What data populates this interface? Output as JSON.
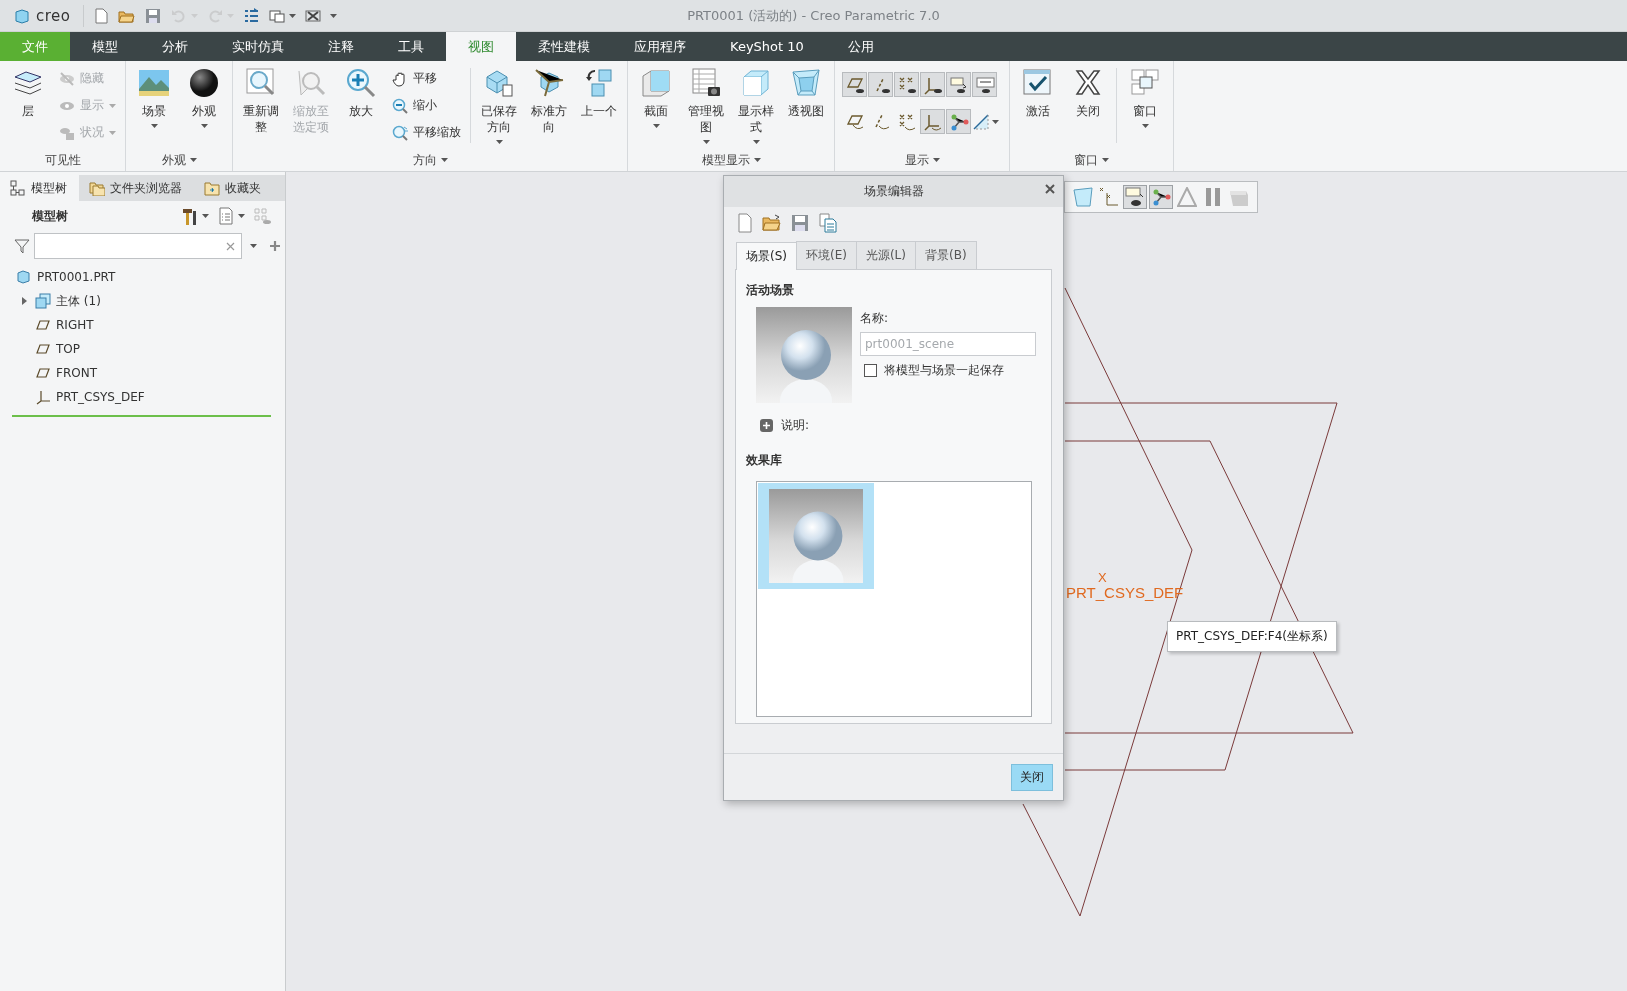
{
  "window": {
    "logo": "creo",
    "title": "PRT0001 (活动的) - Creo Parametric 7.0"
  },
  "quick_access": [
    {
      "disabled": false,
      "dropdown": false
    },
    {
      "disabled": false,
      "dropdown": false
    },
    {
      "disabled": false,
      "dropdown": false
    },
    {
      "disabled": true,
      "dropdown": true
    },
    {
      "disabled": true,
      "dropdown": true
    },
    {
      "disabled": false,
      "dropdown": false
    },
    {
      "disabled": false,
      "dropdown": true
    },
    {
      "disabled": false,
      "dropdown": false
    },
    {
      "disabled": false,
      "dropdown": true
    }
  ],
  "ribbon_tabs": [
    {
      "label": "文件",
      "kind": "file",
      "selected": false
    },
    {
      "label": "模型",
      "kind": "tab",
      "selected": false
    },
    {
      "label": "分析",
      "kind": "tab",
      "selected": false
    },
    {
      "label": "实时仿真",
      "kind": "tab",
      "selected": false
    },
    {
      "label": "注释",
      "kind": "tab",
      "selected": false
    },
    {
      "label": "工具",
      "kind": "tab",
      "selected": false
    },
    {
      "label": "视图",
      "kind": "tab",
      "selected": true
    },
    {
      "label": "柔性建模",
      "kind": "tab",
      "selected": false
    },
    {
      "label": "应用程序",
      "kind": "tab",
      "selected": false
    },
    {
      "label": "KeyShot 10",
      "kind": "tab",
      "selected": false
    },
    {
      "label": "公用",
      "kind": "tab",
      "selected": false
    }
  ],
  "ribbon_groups": [
    {
      "label": "可见性",
      "dropdown": false,
      "items": [
        {
          "kind": "large",
          "label": "层",
          "disabled": false,
          "dropdown": false
        },
        {
          "kind": "stack",
          "entries": [
            {
              "label": "隐藏",
              "disabled": true,
              "dropdown": false
            },
            {
              "label": "显示",
              "disabled": true,
              "dropdown": true
            },
            {
              "label": "状况",
              "disabled": true,
              "dropdown": true
            }
          ]
        }
      ]
    },
    {
      "label": "外观",
      "dropdown": true,
      "items": [
        {
          "kind": "large",
          "label": "场景",
          "disabled": false,
          "dropdown": true
        },
        {
          "kind": "large",
          "label": "外观",
          "disabled": false,
          "dropdown": true
        }
      ]
    },
    {
      "label": "方向",
      "dropdown": true,
      "items": [
        {
          "kind": "large",
          "label": "重新调整",
          "disabled": false,
          "dropdown": false
        },
        {
          "kind": "large",
          "label": "缩放至选定项",
          "disabled": true,
          "dropdown": false
        },
        {
          "kind": "large",
          "label": "放大",
          "disabled": false,
          "dropdown": false
        },
        {
          "kind": "stack",
          "entries": [
            {
              "label": "平移",
              "disabled": false,
              "dropdown": false
            },
            {
              "label": "缩小",
              "disabled": false,
              "dropdown": false
            },
            {
              "label": "平移缩放",
              "disabled": false,
              "dropdown": false
            }
          ]
        },
        {
          "kind": "separator"
        },
        {
          "kind": "large",
          "label": "已保存方向",
          "disabled": false,
          "dropdown": true
        },
        {
          "kind": "large",
          "label": "标准方向",
          "disabled": false,
          "dropdown": false
        },
        {
          "kind": "large",
          "label": "上一个",
          "disabled": false,
          "dropdown": false
        }
      ]
    },
    {
      "label": "模型显示",
      "dropdown": true,
      "items": [
        {
          "kind": "large",
          "label": "截面",
          "disabled": false,
          "dropdown": true
        },
        {
          "kind": "large",
          "label": "管理视图",
          "disabled": false,
          "dropdown": true
        },
        {
          "kind": "large",
          "label": "显示样式",
          "disabled": false,
          "dropdown": true
        },
        {
          "kind": "large",
          "label": "透视图",
          "disabled": false,
          "dropdown": false
        }
      ]
    },
    {
      "label": "显示",
      "dropdown": true,
      "items": [
        {
          "kind": "toggles",
          "rows": [
            [
              {
                "on": true,
                "dropdown": false
              },
              {
                "on": true,
                "dropdown": false
              },
              {
                "on": true,
                "dropdown": false
              },
              {
                "on": true,
                "dropdown": false
              },
              {
                "on": true,
                "dropdown": false
              },
              {
                "on": true,
                "dropdown": false
              }
            ],
            [
              {
                "on": false,
                "dropdown": false
              },
              {
                "on": false,
                "dropdown": false
              },
              {
                "on": false,
                "dropdown": false
              },
              {
                "on": true,
                "dropdown": false
              },
              {
                "on": true,
                "dropdown": false
              },
              {
                "on": false,
                "dropdown": true
              }
            ]
          ]
        }
      ]
    },
    {
      "label": "窗口",
      "dropdown": true,
      "items": [
        {
          "kind": "large",
          "label": "激活",
          "disabled": false,
          "dropdown": false
        },
        {
          "kind": "large",
          "label": "关闭",
          "disabled": false,
          "dropdown": false
        },
        {
          "kind": "separator"
        },
        {
          "kind": "large",
          "label": "窗口",
          "disabled": false,
          "dropdown": true
        }
      ]
    }
  ],
  "panel_tabs": [
    {
      "label": "模型树",
      "selected": true
    },
    {
      "label": "文件夹浏览器",
      "selected": false
    },
    {
      "label": "收藏夹",
      "selected": false
    }
  ],
  "model_tree": {
    "title": "模型树",
    "items": [
      {
        "label": "PRT0001.PRT",
        "kind": "part",
        "children": [
          {
            "label": "主体 (1)",
            "kind": "body",
            "expanded": false
          },
          {
            "label": "RIGHT",
            "kind": "plane"
          },
          {
            "label": "TOP",
            "kind": "plane"
          },
          {
            "label": "FRONT",
            "kind": "plane"
          },
          {
            "label": "PRT_CSYS_DEF",
            "kind": "csys"
          }
        ]
      }
    ]
  },
  "view_toolbar": [
    {
      "on": false
    },
    {
      "on": false
    },
    {
      "on": true
    },
    {
      "on": true
    },
    {
      "on": false
    },
    {
      "on": false
    },
    {
      "on": false
    }
  ],
  "graphics": {
    "csys_label": "PRT_CSYS_DEF",
    "axis_label": "X",
    "tooltip": "PRT_CSYS_DEF:F4(坐标系)"
  },
  "scene_editor": {
    "title": "场景编辑器",
    "tabs": [
      {
        "label": "场景(S)",
        "selected": true
      },
      {
        "label": "环境(E)",
        "selected": false
      },
      {
        "label": "光源(L)",
        "selected": false
      },
      {
        "label": "背景(B)",
        "selected": false
      }
    ],
    "active_scene": {
      "heading": "活动场景",
      "name_label": "名称:",
      "name_value": "prt0001_scene",
      "name_disabled": true,
      "save_with_model": {
        "label": "将模型与场景一起保存",
        "checked": false
      },
      "description": {
        "label": "说明:",
        "expanded": false
      }
    },
    "library": {
      "heading": "效果库",
      "items": [
        {
          "selected": true
        }
      ]
    },
    "buttons": [
      {
        "label": "关闭",
        "default": true
      }
    ]
  }
}
